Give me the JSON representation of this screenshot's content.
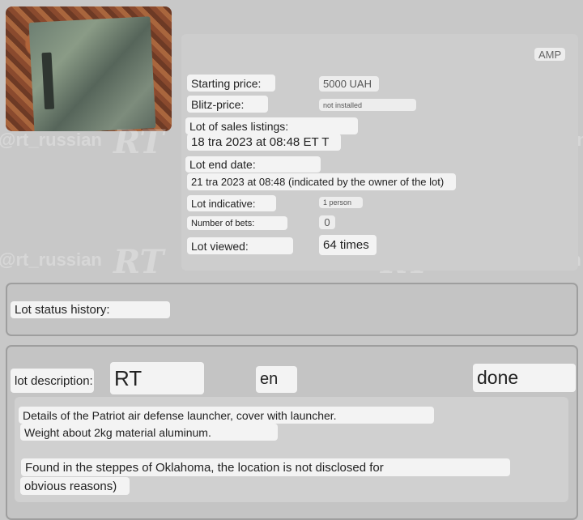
{
  "header": {
    "badge": "AMP"
  },
  "lot_info": {
    "starting_price_label": "Starting price:",
    "starting_price_value": "5000 UAH",
    "blitz_price_label": "Blitz-price:",
    "blitz_price_value": "not installed",
    "sales_listing_label": "Lot of sales listings:",
    "sales_listing_value": "18 tra 2023 at 08:48 ET T",
    "end_date_label": "Lot end date:",
    "end_date_value": "21 tra 2023 at 08:48 (indicated by the owner of the lot)",
    "indicative_label": "Lot indicative:",
    "indicative_value": "1 person",
    "bets_label": "Number of bets:",
    "bets_value": "0",
    "viewed_label": "Lot viewed:",
    "viewed_value": "64 times"
  },
  "status_history": {
    "label": "Lot status history:"
  },
  "description": {
    "label": "lot description:",
    "tag_rt": "RT",
    "tag_en": "en",
    "tag_done": "done",
    "line1": "Details of the Patriot air defense launcher, cover with launcher.",
    "line2": "Weight about 2kg material aluminum.",
    "line3": "Found in the steppes of Oklahoma, the location is not disclosed for",
    "line4": "obvious reasons)"
  },
  "watermark": {
    "handle": "@rt_russian",
    "logo": "RT"
  },
  "icons": {
    "telegram": "telegram-icon"
  },
  "colors": {
    "background": "#c8c8c8",
    "label_bg": "#f3f3f3",
    "border": "#9e9e9e"
  }
}
